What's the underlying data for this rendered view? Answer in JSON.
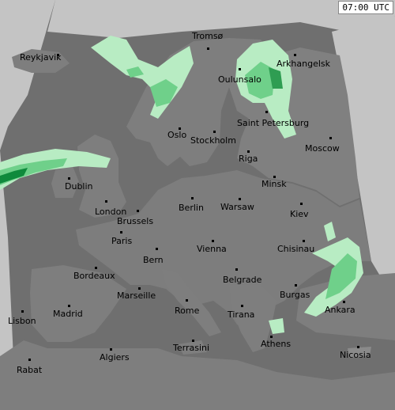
{
  "timestamp": "07:00 UTC",
  "colors": {
    "sea": "#6f6f6f",
    "land": "#7d7d7d",
    "outside": "#c0c0c0",
    "precip_light": "#b8ecc3",
    "precip_mid": "#6fd08a",
    "precip_heavy": "#0f8a3c"
  },
  "cities": [
    {
      "name": "Tromsø"
    },
    {
      "name": "Reykjavik"
    },
    {
      "name": "Arkhangelsk"
    },
    {
      "name": "Oulunsalo"
    },
    {
      "name": "Saint Petersburg"
    },
    {
      "name": "Oslo"
    },
    {
      "name": "Stockholm"
    },
    {
      "name": "Moscow"
    },
    {
      "name": "Riga"
    },
    {
      "name": "Dublin"
    },
    {
      "name": "Minsk"
    },
    {
      "name": "Berlin"
    },
    {
      "name": "Warsaw"
    },
    {
      "name": "Kiev"
    },
    {
      "name": "London"
    },
    {
      "name": "Brussels"
    },
    {
      "name": "Paris"
    },
    {
      "name": "Chisinau"
    },
    {
      "name": "Bern"
    },
    {
      "name": "Vienna"
    },
    {
      "name": "Bordeaux"
    },
    {
      "name": "Belgrade"
    },
    {
      "name": "Marseille"
    },
    {
      "name": "Burgas"
    },
    {
      "name": "Madrid"
    },
    {
      "name": "Rome"
    },
    {
      "name": "Tirana"
    },
    {
      "name": "Ankara"
    },
    {
      "name": "Lisbon"
    },
    {
      "name": "Athens"
    },
    {
      "name": "Terrasini"
    },
    {
      "name": "Nicosia"
    },
    {
      "name": "Rabat"
    },
    {
      "name": "Algiers"
    }
  ]
}
